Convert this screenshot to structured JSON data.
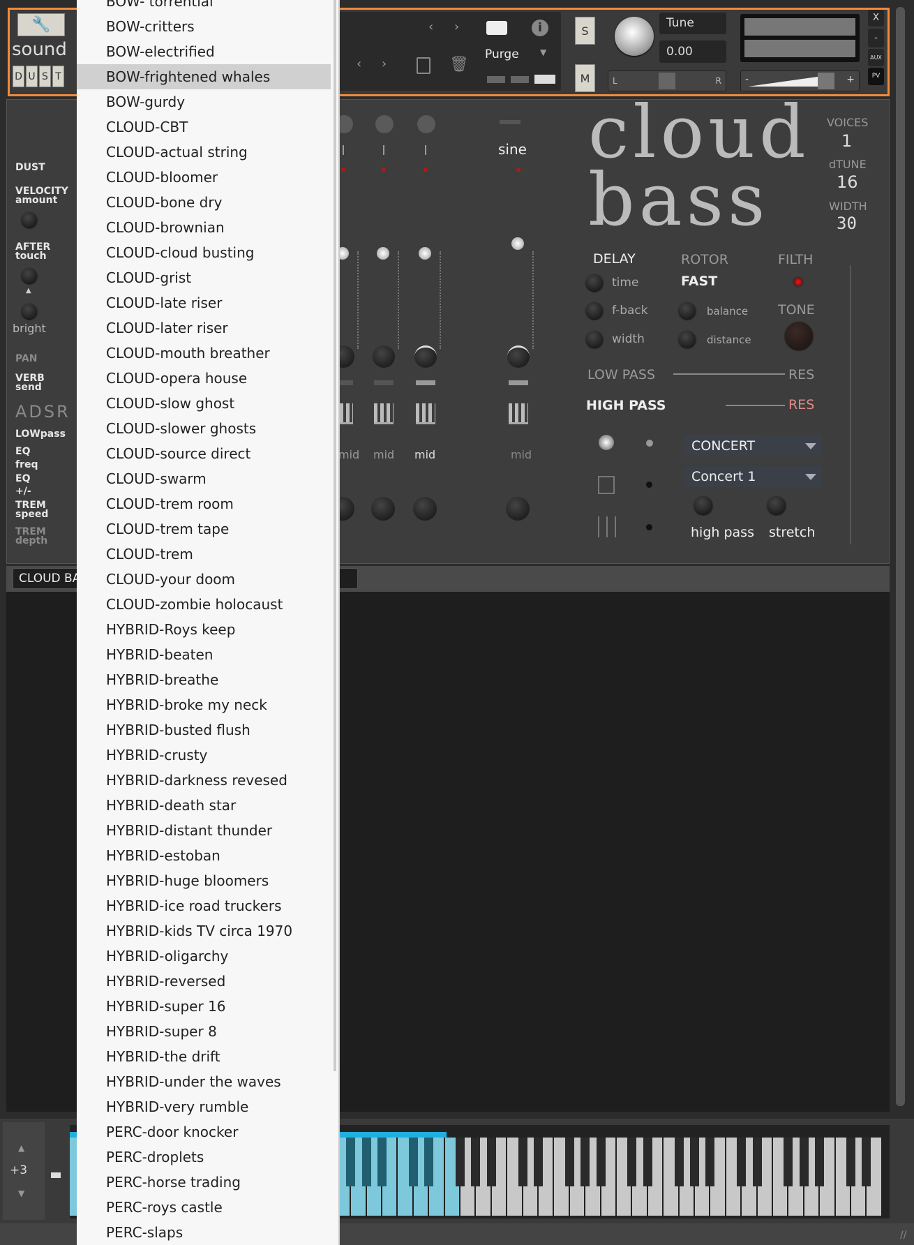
{
  "header": {
    "logo_word": "sound",
    "logo_letters": [
      "D",
      "U",
      "S",
      "T"
    ],
    "purge_label": "Purge",
    "solo_label": "S",
    "mute_label": "M",
    "tune_label": "Tune",
    "tune_value": "0.00",
    "pan_left": "L",
    "pan_right": "R",
    "vol_minus": "-",
    "vol_plus": "+",
    "close_label": "X",
    "minimize_label": "-",
    "aux_label": "AUX",
    "pv_label": "PV"
  },
  "left_strip": {
    "dust": "DUST",
    "velocity": "VELOCITY",
    "velocity_sub": "amount",
    "after": "AFTER",
    "after_sub": "touch",
    "bright": "bright",
    "pan": "PAN",
    "verb": "VERB",
    "verb_sub": "send",
    "adsr": "ADSR",
    "lowpass": "LOWpass",
    "eq1": "EQ",
    "eq1_sub": "freq",
    "eq2": "EQ",
    "eq2_sub": "+/-",
    "trem1": "TREM",
    "trem1_sub": "speed",
    "trem2": "TREM",
    "trem2_sub": "depth"
  },
  "instrument": {
    "title_line1": "cloud",
    "title_line2": "bass",
    "voices_label": "VOICES",
    "voices_value": "1",
    "dtune_label": "dTUNE",
    "dtune_value": "16",
    "width_label": "WIDTH",
    "width_value": "30",
    "sine_label": "sine",
    "mid_labels": [
      "mid",
      "mid",
      "mid",
      "mid"
    ],
    "delay_label": "DELAY",
    "delay_time": "time",
    "delay_fback": "f-back",
    "delay_width": "width",
    "rotor_label": "ROTOR",
    "rotor_speed": "FAST",
    "rotor_balance": "balance",
    "rotor_distance": "distance",
    "filth_label": "FILTH",
    "tone_label": "TONE",
    "low_pass_label": "LOW PASS",
    "high_pass_label": "HIGH PASS",
    "res_label": "RES",
    "res_label_2": "RES",
    "room_select": "CONCERT",
    "preset_select": "Concert 1",
    "high_pass_knob": "high pass",
    "stretch_knob": "stretch",
    "res_active_color": "#e08a8a"
  },
  "tab": {
    "label": "CLOUD BASS"
  },
  "keyboard": {
    "octave": "+3",
    "highlight_color": "#7ec8dc"
  },
  "menu": {
    "selected_index": 3,
    "items": [
      "BOW- torrential",
      "BOW-critters",
      "BOW-electrified",
      "BOW-frightened whales",
      "BOW-gurdy",
      "CLOUD-CBT",
      "CLOUD-actual string",
      "CLOUD-bloomer",
      "CLOUD-bone dry",
      "CLOUD-brownian",
      "CLOUD-cloud busting",
      "CLOUD-grist",
      "CLOUD-late riser",
      "CLOUD-later riser",
      "CLOUD-mouth breather",
      "CLOUD-opera house",
      "CLOUD-slow ghost",
      "CLOUD-slower ghosts",
      "CLOUD-source direct",
      "CLOUD-swarm",
      "CLOUD-trem room",
      "CLOUD-trem tape",
      "CLOUD-trem",
      "CLOUD-your doom",
      "CLOUD-zombie holocaust",
      "HYBRID-Roys keep",
      "HYBRID-beaten",
      "HYBRID-breathe",
      "HYBRID-broke my neck",
      "HYBRID-busted flush",
      "HYBRID-crusty",
      "HYBRID-darkness revesed",
      "HYBRID-death star",
      "HYBRID-distant thunder",
      "HYBRID-estoban",
      "HYBRID-huge bloomers",
      "HYBRID-ice road truckers",
      "HYBRID-kids TV circa 1970",
      "HYBRID-oligarchy",
      "HYBRID-reversed",
      "HYBRID-super 16",
      "HYBRID-super 8",
      "HYBRID-the drift",
      "HYBRID-under the waves",
      "HYBRID-very rumble",
      "PERC-door knocker",
      "PERC-droplets",
      "PERC-horse trading",
      "PERC-roys castle",
      "PERC-slaps"
    ]
  }
}
